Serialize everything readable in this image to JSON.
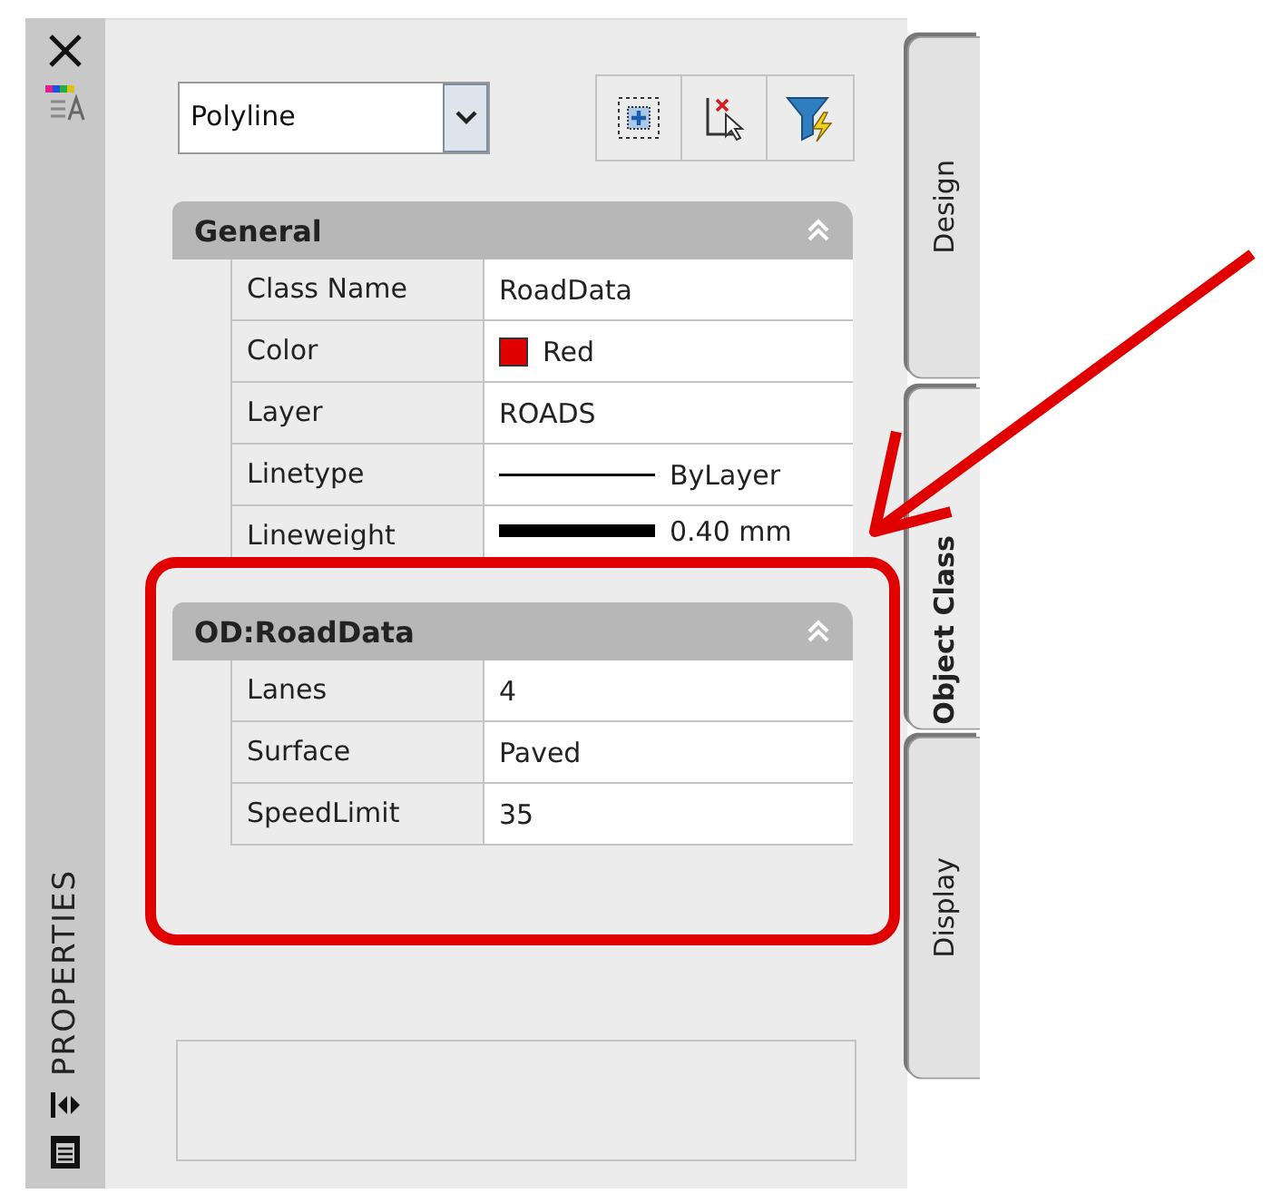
{
  "panel": {
    "title": "PROPERTIES"
  },
  "object_select": {
    "value": "Polyline"
  },
  "sections": [
    {
      "title": "General",
      "expanded": true,
      "rows": [
        {
          "label": "Class Name",
          "value": "RoadData",
          "kind": "text"
        },
        {
          "label": "Color",
          "value": "Red",
          "kind": "color",
          "color": "#e00000"
        },
        {
          "label": "Layer",
          "value": "ROADS",
          "kind": "text"
        },
        {
          "label": "Linetype",
          "value": "ByLayer",
          "kind": "linetype"
        },
        {
          "label": "Lineweight",
          "value": "0.40 mm",
          "kind": "lineweight"
        }
      ]
    },
    {
      "title": "OD:RoadData",
      "expanded": true,
      "rows": [
        {
          "label": "Lanes",
          "value": "4",
          "kind": "text"
        },
        {
          "label": "Surface",
          "value": "Paved",
          "kind": "text"
        },
        {
          "label": "SpeedLimit",
          "value": "35",
          "kind": "text"
        }
      ]
    }
  ],
  "tabs": [
    {
      "label": "Design",
      "selected": false
    },
    {
      "label": "Object Class",
      "selected": true
    },
    {
      "label": "Display",
      "selected": false
    }
  ]
}
